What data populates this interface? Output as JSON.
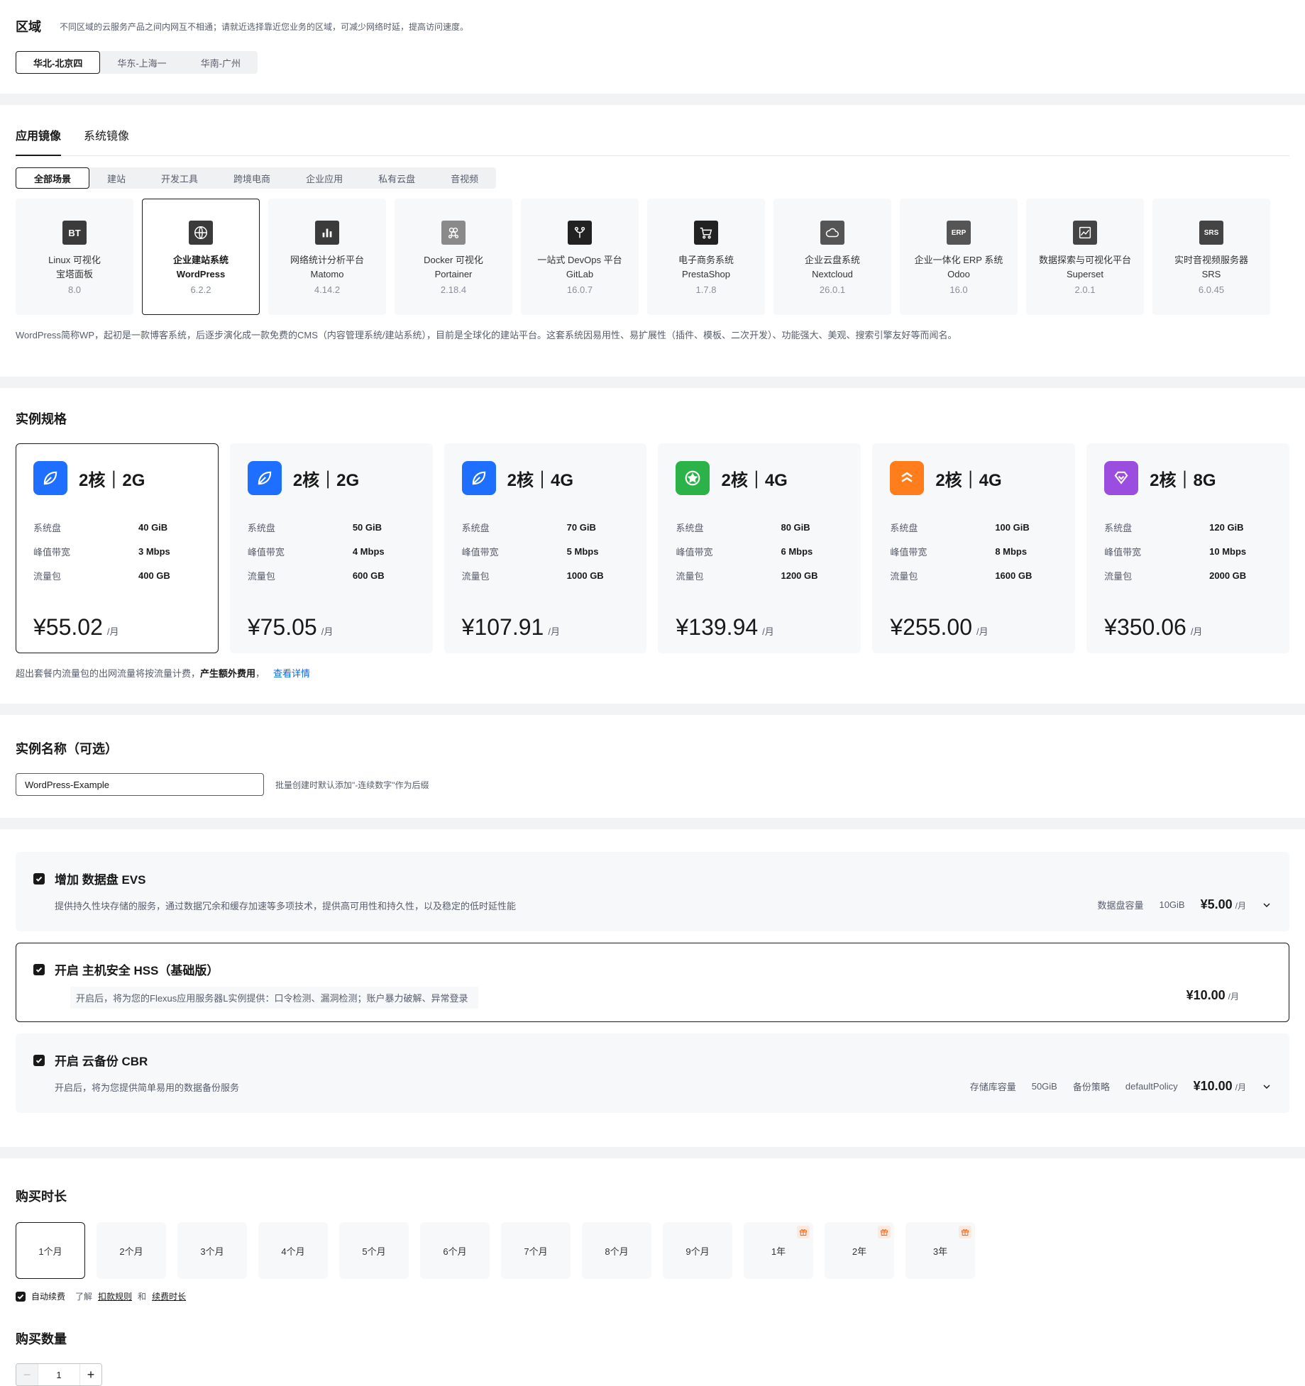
{
  "region": {
    "title": "区域",
    "hint": "不同区域的云服务产品之间内网互不相通；请就近选择靠近您业务的区域，可减少网络时延，提高访问速度。",
    "options": [
      "华北-北京四",
      "华东-上海一",
      "华南-广州"
    ],
    "selected": 0
  },
  "image": {
    "tabs": [
      "应用镜像",
      "系统镜像"
    ],
    "categories": [
      "全部场景",
      "建站",
      "开发工具",
      "跨境电商",
      "企业应用",
      "私有云盘",
      "音视频"
    ],
    "apps": [
      {
        "line1": "Linux 可视化",
        "line2": "宝塔面板",
        "version": "8.0",
        "icon": "bt-icon",
        "icon_text": "BT"
      },
      {
        "line1": "企业建站系统",
        "line2": "WordPress",
        "version": "6.2.2",
        "icon": "wordpress-icon",
        "icon_text": ""
      },
      {
        "line1": "网络统计分析平台",
        "line2": "Matomo",
        "version": "4.14.2",
        "icon": "bar-chart-icon",
        "icon_text": ""
      },
      {
        "line1": "Docker 可视化",
        "line2": "Portainer",
        "version": "2.18.4",
        "icon": "docker-icon",
        "icon_text": ""
      },
      {
        "line1": "一站式 DevOps 平台",
        "line2": "GitLab",
        "version": "16.0.7",
        "icon": "git-branch-icon",
        "icon_text": ""
      },
      {
        "line1": "电子商务系统",
        "line2": "PrestaShop",
        "version": "1.7.8",
        "icon": "shopping-cart-icon",
        "icon_text": ""
      },
      {
        "line1": "企业云盘系统",
        "line2": "Nextcloud",
        "version": "26.0.1",
        "icon": "cloud-icon",
        "icon_text": ""
      },
      {
        "line1": "企业一体化 ERP 系统",
        "line2": "Odoo",
        "version": "16.0",
        "icon": "erp-icon",
        "icon_text": "ERP"
      },
      {
        "line1": "数据探索与可视化平台",
        "line2": "Superset",
        "version": "2.0.1",
        "icon": "line-chart-icon",
        "icon_text": ""
      },
      {
        "line1": "实时音视频服务器",
        "line2": "SRS",
        "version": "6.0.45",
        "icon": "srs-icon",
        "icon_text": "SRS"
      }
    ],
    "selected": 1,
    "description": "WordPress简称WP，起初是一款博客系统，后逐步演化成一款免费的CMS（内容管理系统/建站系统），目前是全球化的建站平台。这套系统因易用性、易扩展性（插件、模板、二次开发）、功能强大、美观、搜索引擎友好等而闻名。"
  },
  "spec": {
    "title": "实例规格",
    "labels": {
      "disk": "系统盘",
      "bandwidth": "峰值带宽",
      "traffic": "流量包"
    },
    "plans": [
      {
        "title": "2核｜2G",
        "disk": "40 GiB",
        "bandwidth": "3 Mbps",
        "traffic": "400 GB",
        "price": "¥55.02",
        "unit": "/月",
        "color": "#1e6fff",
        "icon": "leaf-icon"
      },
      {
        "title": "2核｜2G",
        "disk": "50 GiB",
        "bandwidth": "4 Mbps",
        "traffic": "600 GB",
        "price": "¥75.05",
        "unit": "/月",
        "color": "#1e6fff",
        "icon": "leaf-icon"
      },
      {
        "title": "2核｜4G",
        "disk": "70 GiB",
        "bandwidth": "5 Mbps",
        "traffic": "1000 GB",
        "price": "¥107.91",
        "unit": "/月",
        "color": "#1e6fff",
        "icon": "leaf-icon"
      },
      {
        "title": "2核｜4G",
        "disk": "80 GiB",
        "bandwidth": "6 Mbps",
        "traffic": "1200 GB",
        "price": "¥139.94",
        "unit": "/月",
        "color": "#2bb34a",
        "icon": "star-badge-icon"
      },
      {
        "title": "2核｜4G",
        "disk": "100 GiB",
        "bandwidth": "8 Mbps",
        "traffic": "1600 GB",
        "price": "¥255.00",
        "unit": "/月",
        "color": "#ff7d1a",
        "icon": "stack-icon"
      },
      {
        "title": "2核｜8G",
        "disk": "120 GiB",
        "bandwidth": "10 Mbps",
        "traffic": "2000 GB",
        "price": "¥350.06",
        "unit": "/月",
        "color": "#9b4de0",
        "icon": "diamond-icon"
      }
    ],
    "selected": 0,
    "note_prefix": "超出套餐内流量包的出网流量将按流量计费，",
    "note_strong": "产生额外费用",
    "note_comma": "，",
    "note_link": "查看详情"
  },
  "name": {
    "title": "实例名称（可选）",
    "value": "WordPress-Example",
    "hint": "批量创建时默认添加\"-连续数字\"作为后缀"
  },
  "addons": [
    {
      "title": "增加 数据盘 EVS",
      "desc": "提供持久性块存储的服务，通过数据冗余和缓存加速等多项技术，提供高可用性和持久性，以及稳定的低时延性能",
      "k1": "数据盘容量",
      "v1": "10GiB",
      "k2": "",
      "v2": "",
      "price": "¥5.00",
      "unit": "/月"
    },
    {
      "title": "开启 主机安全 HSS（基础版）",
      "desc": "开启后，将为您的Flexus应用服务器L实例提供：口令检测、漏洞检测；账户暴力破解、异常登录",
      "price": "¥10.00",
      "unit": "/月"
    },
    {
      "title": "开启 云备份 CBR",
      "desc": "开启后，将为您提供简单易用的数据备份服务",
      "k1": "存储库容量",
      "v1": "50GiB",
      "k2": "备份策略",
      "v2": "defaultPolicy",
      "price": "¥10.00",
      "unit": "/月"
    }
  ],
  "duration": {
    "title": "购买时长",
    "options": [
      "1个月",
      "2个月",
      "3个月",
      "4个月",
      "5个月",
      "6个月",
      "7个月",
      "8个月",
      "9个月",
      "1年",
      "2年",
      "3年"
    ],
    "selected": 0,
    "auto_renew": "自动续费",
    "learn": "了解",
    "rule_link": "扣款规则",
    "and": "和",
    "period_link": "续费时长"
  },
  "quantity": {
    "title": "购买数量",
    "value": "1",
    "minus": "−",
    "plus": "+"
  }
}
